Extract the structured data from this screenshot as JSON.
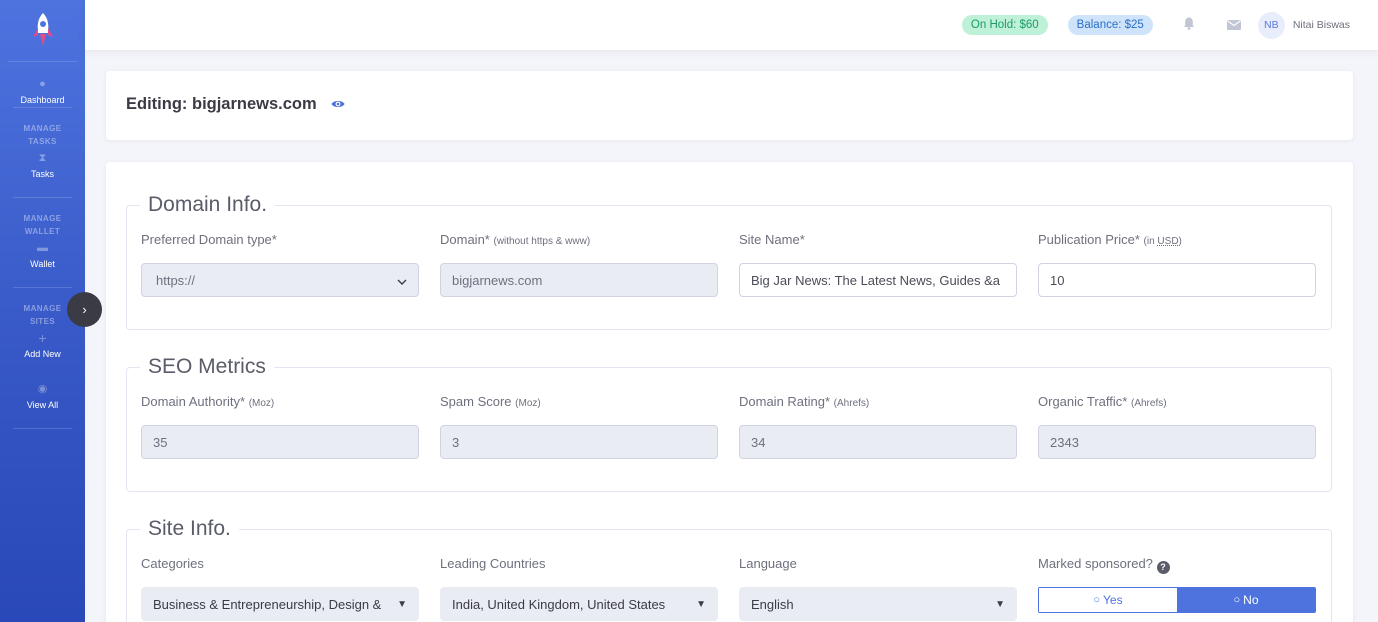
{
  "topbar": {
    "on_hold": "On Hold: $60",
    "balance": "Balance: $25",
    "bell_icon": "bell-icon",
    "mail_icon": "envelope-icon",
    "avatar_initials": "NB",
    "user_name": "Nitai Biswas"
  },
  "sidebar": {
    "logo_icon": "rocket-icon",
    "dashboard": "Dashboard",
    "heading_tasks": "MANAGE TASKS",
    "tasks": "Tasks",
    "heading_wallet": "MANAGE WALLET",
    "wallet": "Wallet",
    "heading_sites": "MANAGE SITES",
    "add_new": "Add New",
    "view_all": "View All"
  },
  "page": {
    "title": "Editing: bigjarnews.com"
  },
  "domain_info": {
    "legend": "Domain Info.",
    "preferred_type_label": "Preferred Domain type*",
    "preferred_type_value": "https://",
    "domain_label": "Domain*",
    "domain_hint": "(without https & www)",
    "domain_value": "bigjarnews.com",
    "site_name_label": "Site Name*",
    "site_name_value": "Big Jar News: The Latest News, Guides &a",
    "price_label": "Publication Price*",
    "price_hint_prefix": "(in ",
    "price_hint_unit": "USD",
    "price_hint_suffix": ")",
    "price_value": "10"
  },
  "seo_metrics": {
    "legend": "SEO Metrics",
    "da_label": "Domain Authority*",
    "da_hint": "(Moz)",
    "da_value": "35",
    "spam_label": "Spam Score",
    "spam_hint": "(Moz)",
    "spam_value": "3",
    "dr_label": "Domain Rating*",
    "dr_hint": "(Ahrefs)",
    "dr_value": "34",
    "traffic_label": "Organic Traffic*",
    "traffic_hint": "(Ahrefs)",
    "traffic_value": "2343"
  },
  "site_info": {
    "legend": "Site Info.",
    "categories_label": "Categories",
    "categories_value": "Business & Entrepreneurship, Design &",
    "countries_label": "Leading Countries",
    "countries_value": "India, United Kingdom, United States",
    "language_label": "Language",
    "language_value": "English",
    "sponsored_label": "Marked sponsored?",
    "sponsored_yes": "Yes",
    "sponsored_no": "No",
    "sponsored_selected": "No"
  },
  "colors": {
    "primary": "#4e73df",
    "on_hold_bg": "#bff0d8",
    "balance_bg": "#cfe4fb"
  }
}
